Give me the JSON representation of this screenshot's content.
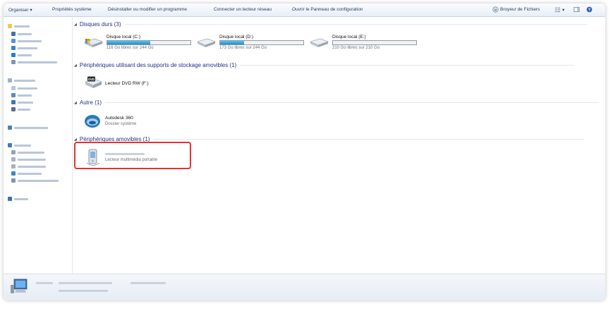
{
  "toolbar": {
    "items": [
      "Organiser ▾",
      "Propriétés système",
      "Désinstaller ou modifier un programme",
      "Connecter un lecteur réseau",
      "Ouvrir le Panneau de configuration"
    ],
    "shredder": "Broyeur de Fichiers",
    "view_arrow": "▾"
  },
  "groups": {
    "hard_drives": "Disques durs (3)",
    "removable_storage": "Périphériques utilisant des supports de stockage amovibles (1)",
    "other": "Autre (1)",
    "removable_devices": "Périphériques amovibles (1)"
  },
  "drives": [
    {
      "name": "Disque local (C:)",
      "free": "116 Go libres sur 244 Go",
      "used_fraction": 0.52
    },
    {
      "name": "Disque local (D:)",
      "free": "173 Go libres sur 244 Go",
      "used_fraction": 0.29
    },
    {
      "name": "Disque local (E:)",
      "free": "210 Go libres sur 210 Go",
      "used_fraction": 0.0
    }
  ],
  "dvd": {
    "name": "Lecteur DVD RW (F:)",
    "label": "DVD"
  },
  "autodesk": {
    "name": "Autodesk 360",
    "sub": "Dossier système"
  },
  "portable": {
    "sub": "Lecteur multimédia portable"
  },
  "colors": {
    "accent": "#1e3287",
    "highlight": "#e53232",
    "bar_fill": "#26a0da"
  }
}
